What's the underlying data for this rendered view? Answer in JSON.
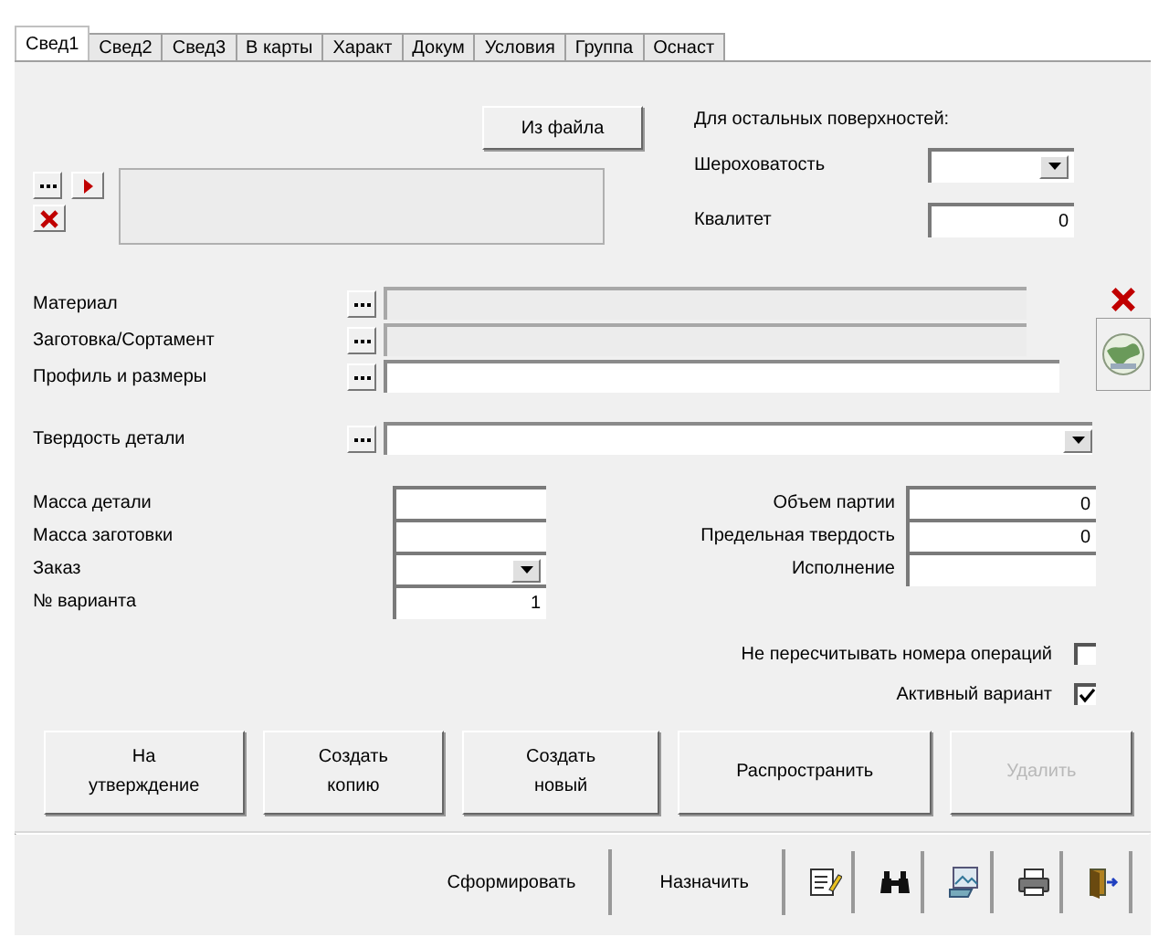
{
  "tabs": [
    {
      "label": "Свед1",
      "selected": true
    },
    {
      "label": "Свед2",
      "selected": false
    },
    {
      "label": "Свед3",
      "selected": false
    },
    {
      "label": "В карты",
      "selected": false
    },
    {
      "label": "Характ",
      "selected": false
    },
    {
      "label": "Докум",
      "selected": false
    },
    {
      "label": "Условия",
      "selected": false
    },
    {
      "label": "Группа",
      "selected": false
    },
    {
      "label": "Оснаст",
      "selected": false
    }
  ],
  "file_button": "Из файла",
  "surface_heading": "Для остальных поверхностей:",
  "roughness": {
    "label": "Шероховатость"
  },
  "quality": {
    "label": "Квалитет",
    "value": "0"
  },
  "reference_fields": [
    {
      "label": "Материал",
      "kind": "text",
      "disabled": true
    },
    {
      "label": "Заготовка/Сортамент",
      "kind": "text",
      "disabled": true
    },
    {
      "label": "Профиль и размеры",
      "kind": "text",
      "disabled": false
    },
    {
      "label": "Твердость детали",
      "kind": "combo",
      "disabled": false
    }
  ],
  "left_fields": [
    {
      "label": "Масса детали",
      "kind": "text"
    },
    {
      "label": "Масса заготовки",
      "kind": "text"
    },
    {
      "label": "Заказ",
      "kind": "combo"
    },
    {
      "label": "№ варианта",
      "kind": "text",
      "value": "1"
    }
  ],
  "right_fields": [
    {
      "label": "Объем партии",
      "value": "0"
    },
    {
      "label": "Предельная твердость",
      "value": "0"
    },
    {
      "label": "Исполнение"
    }
  ],
  "checkboxes": [
    {
      "label": "Не пересчитывать номера операций",
      "checked": false
    },
    {
      "label": "Активный вариант",
      "checked": true
    }
  ],
  "action_buttons": [
    {
      "label": "На\nутверждение",
      "disabled": false
    },
    {
      "label": "Создать\nкопию",
      "disabled": false
    },
    {
      "label": "Создать\nновый",
      "disabled": false
    },
    {
      "label": "Распространить",
      "disabled": false
    },
    {
      "label": "Удалить",
      "disabled": true
    }
  ],
  "toolbar_buttons": [
    {
      "label": "Сформировать"
    },
    {
      "label": "Назначить"
    }
  ]
}
